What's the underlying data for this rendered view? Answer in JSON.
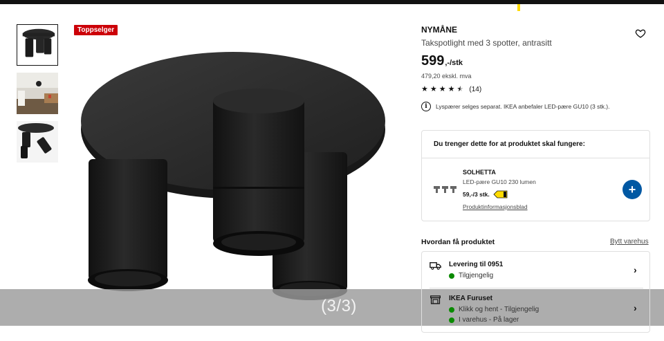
{
  "gallery": {
    "badge": "Toppselger",
    "counter": "(3/3)"
  },
  "product": {
    "name": "NYMÅNE",
    "description": "Takspotlight med 3 spotter, antrasitt",
    "price": "599",
    "price_suffix": ",-/stk",
    "price_exvat": "479,20 ekskl. mva",
    "rating": 4.5,
    "rating_count": "(14)",
    "notice": "Lyspærer selges separat. IKEA anbefaler LED-pære GU10 (3 stk.)."
  },
  "requirement": {
    "title": "Du trenger dette for at produktet skal fungere:",
    "item_name": "SOLHETTA",
    "item_desc": "LED-pære GU10 230 lumen",
    "item_price": "59,-/3 stk.",
    "item_link": "Produktinformasjonsblad",
    "add_label": "+",
    "energy_tag_color": "#ffdb00"
  },
  "delivery": {
    "title": "Hvordan få produktet",
    "change_store": "Bytt varehus",
    "options": [
      {
        "icon": "truck-icon",
        "title": "Levering til 0951",
        "statuses": [
          "Tilgjengelig"
        ]
      },
      {
        "icon": "store-icon",
        "title": "IKEA Furuset",
        "statuses": [
          "Klikk og hent - Tilgjengelig",
          "I varehus - På lager"
        ]
      }
    ],
    "status_color": "#0a8a00"
  },
  "colors": {
    "badge": "#cc0008",
    "add_button": "#0058a3"
  }
}
